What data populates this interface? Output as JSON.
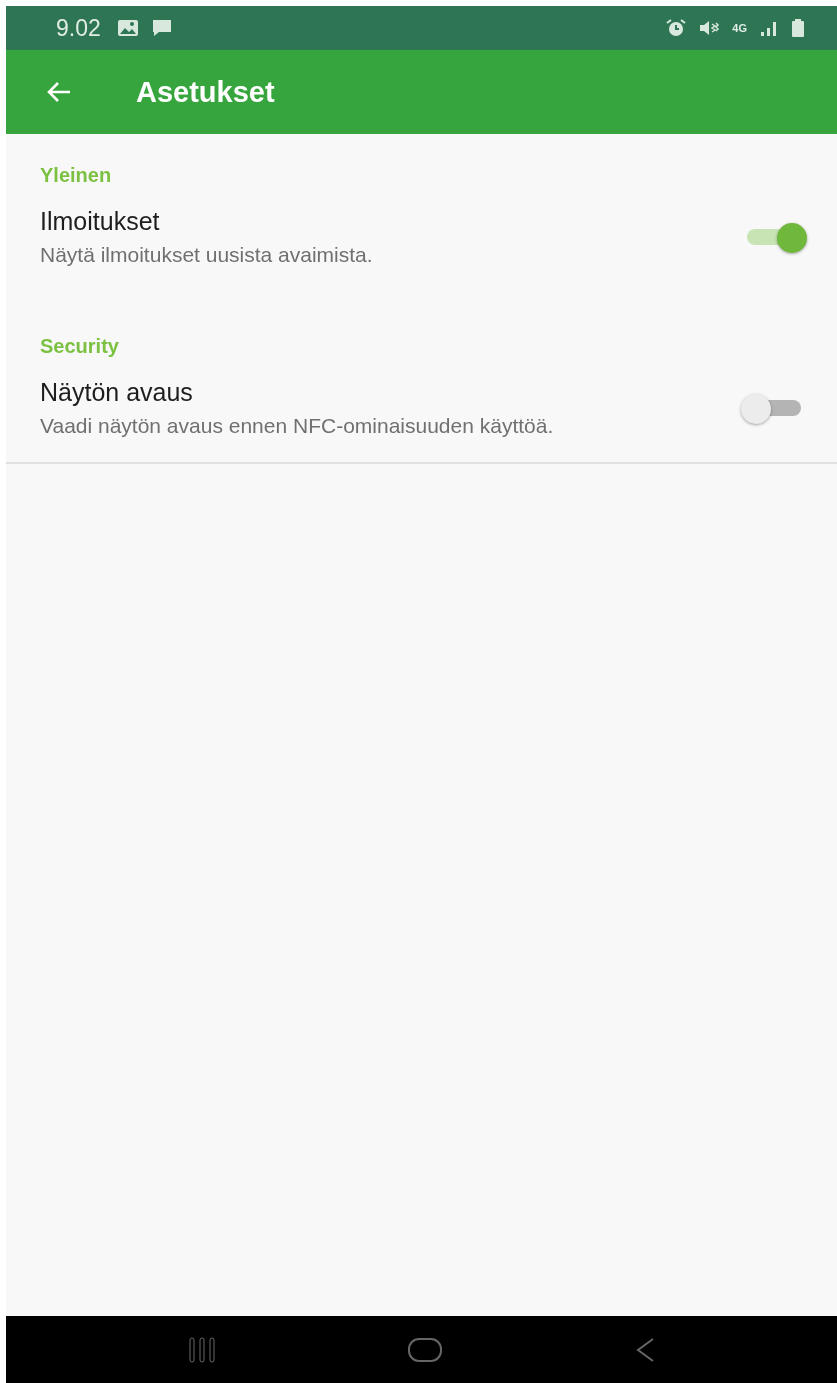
{
  "status_bar": {
    "time": "9.02",
    "network": "4G"
  },
  "app_bar": {
    "title": "Asetukset"
  },
  "sections": [
    {
      "title": "Yleinen",
      "items": [
        {
          "title": "Ilmoitukset",
          "summary": "Näytä ilmoitukset uusista avaimista.",
          "on": true
        }
      ]
    },
    {
      "title": "Security",
      "items": [
        {
          "title": "Näytön avaus",
          "summary": "Vaadi näytön avaus ennen NFC-ominaisuuden käyttöä.",
          "on": false
        }
      ]
    }
  ]
}
